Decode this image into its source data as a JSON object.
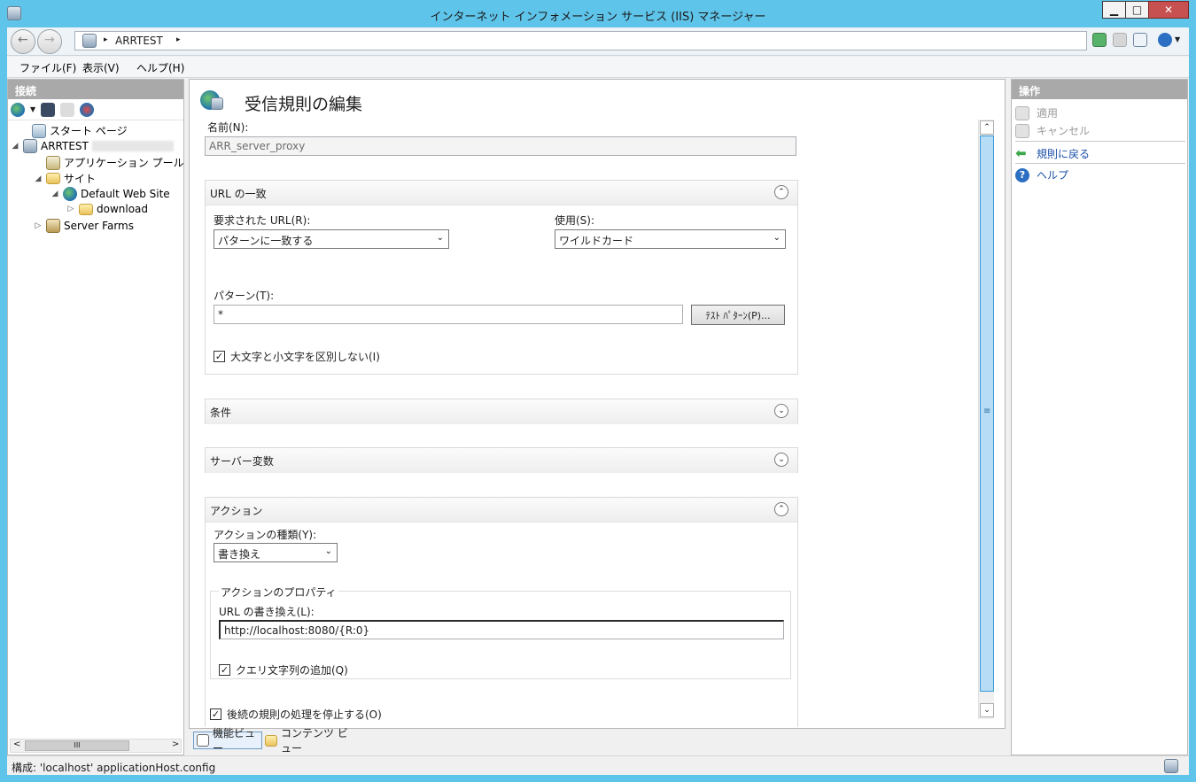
{
  "window": {
    "title": "インターネット インフォメーション サービス (IIS) マネージャー",
    "minimize": "▁",
    "maximize": "□",
    "close": "✕"
  },
  "address": {
    "separator": "▸",
    "crumb": "ARRTEST",
    "trailing": "▸"
  },
  "menu": {
    "file": "ファイル(F)",
    "view": "表示(V)",
    "help": "ヘルプ(H)"
  },
  "connections": {
    "header": "接続",
    "tree": {
      "start": "スタート ページ",
      "server": "ARRTEST",
      "app_pools": "アプリケーション プール",
      "sites": "サイト",
      "default_site": "Default Web Site",
      "download": "download",
      "server_farms": "Server Farms"
    },
    "hscroll_thumb": "III"
  },
  "main": {
    "title": "受信規則の編集",
    "name_label": "名前(N):",
    "name_value": "ARR_server_proxy",
    "url_match": {
      "header": "URL の一致",
      "requested_url_label": "要求された URL(R):",
      "requested_url_value": "パターンに一致する",
      "using_label": "使用(S):",
      "using_value": "ワイルドカード",
      "pattern_label": "パターン(T):",
      "pattern_value": "*",
      "test_button": "ﾃｽﾄ ﾊﾟﾀｰﾝ(P)...",
      "ignore_case_label": "大文字と小文字を区別しない(I)"
    },
    "conditions": {
      "header": "条件"
    },
    "server_vars": {
      "header": "サーバー変数"
    },
    "action": {
      "header": "アクション",
      "type_label": "アクションの種類(Y):",
      "type_value": "書き換え",
      "props_legend": "アクションのプロパティ",
      "rewrite_label": "URL の書き換え(L):",
      "rewrite_value": "http://localhost:8080/{R:0}",
      "append_query_label": "クエリ文字列の追加(Q)",
      "stop_processing_label": "後続の規則の処理を停止する(O)"
    },
    "expand_glyph": "⌃",
    "collapse_glyph": "⌄",
    "combo_arrow": "⌄"
  },
  "view_tabs": {
    "features": "機能ビュー",
    "content": "コンテンツ ビュー"
  },
  "actions": {
    "header": "操作",
    "apply": "適用",
    "cancel": "キャンセル",
    "back": "規則に戻る",
    "help": "ヘルプ"
  },
  "status": {
    "text": "構成: 'localhost' applicationHost.config"
  },
  "colors": {
    "title_bar": "#5fc4ea",
    "pane_header": "#a9a9a9",
    "link": "#1a4fa8",
    "scroll_thumb": "#b7dcf5"
  }
}
